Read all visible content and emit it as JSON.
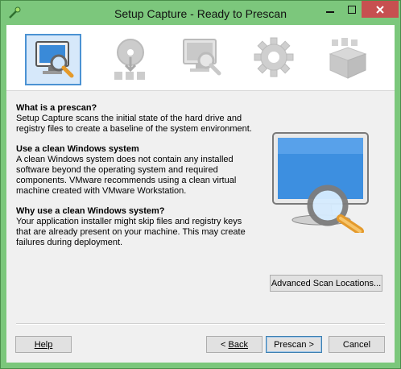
{
  "window": {
    "title": "Setup Capture - Ready to Prescan"
  },
  "steps": [
    {
      "name": "prescan",
      "active": true
    },
    {
      "name": "install",
      "active": false
    },
    {
      "name": "postscan",
      "active": false
    },
    {
      "name": "configure",
      "active": false
    },
    {
      "name": "package",
      "active": false
    }
  ],
  "sections": [
    {
      "heading": "What is a prescan?",
      "body": "Setup Capture scans the initial state of the hard drive and registry files to create a baseline of the system environment."
    },
    {
      "heading": "Use a clean Windows system",
      "body": "A clean Windows system does not contain any installed software beyond the operating system and required components. VMware recommends using a clean virtual machine created with VMware Workstation."
    },
    {
      "heading": "Why use a clean Windows system?",
      "body": "Your application installer might skip files and registry keys that are already present on your machine. This may create failures during deployment."
    }
  ],
  "buttons": {
    "advanced": "Advanced Scan Locations...",
    "help": "Help",
    "back_prefix": "< ",
    "back": "Back",
    "prescan": "Prescan >",
    "cancel": "Cancel"
  },
  "colors": {
    "titlebar": "#7cc77c",
    "close": "#c75050",
    "accent": "#4b92d3"
  }
}
